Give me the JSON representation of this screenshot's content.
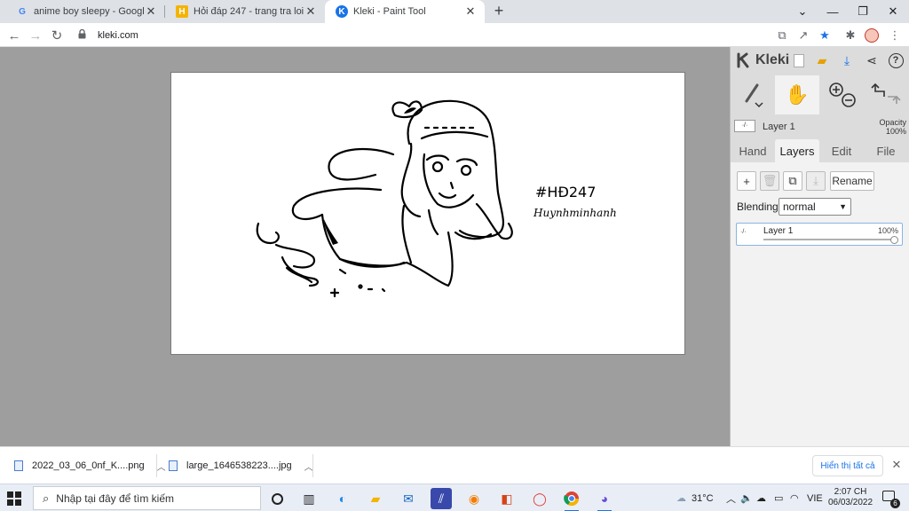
{
  "browser": {
    "tabs": [
      {
        "title": "anime boy sleepy - Google Tìm k",
        "icon": "google-icon",
        "active": false
      },
      {
        "title": "Hỏi đáp 247 - trang tra loi",
        "icon": "hoidap-icon",
        "active": false
      },
      {
        "title": "Kleki - Paint Tool",
        "icon": "kleki-icon",
        "active": true
      }
    ],
    "new_tab": "+",
    "window_controls": {
      "dropdown": "⌄",
      "minimize": "—",
      "restore": "❐",
      "close": "✕"
    },
    "nav": {
      "back": "←",
      "forward": "→",
      "reload": "↻"
    },
    "url": "kleki.com"
  },
  "kleki": {
    "logo_text": "Kleki",
    "tools": [
      "brush-tool",
      "hand-tool",
      "zoom-tool",
      "undo-redo"
    ],
    "layer_preview": {
      "name": "Layer 1",
      "opacity_label": "Opacity",
      "opacity_value": "100%"
    },
    "tabs": [
      {
        "label": "Hand",
        "active": false
      },
      {
        "label": "Layers",
        "active": true
      },
      {
        "label": "Edit",
        "active": false
      },
      {
        "label": "File",
        "active": false
      }
    ],
    "layer_buttons": {
      "add": "+",
      "delete": "🗑",
      "duplicate": "⧉",
      "merge": "⤓",
      "rename": "Rename"
    },
    "blending_label": "Blending",
    "blending_value": "normal",
    "layers": [
      {
        "name": "Layer 1",
        "opacity": "100%",
        "opacity_fraction": 1.0
      }
    ],
    "canvas_text": {
      "line1": "#HĐ247",
      "line2": "Huynhminhanh"
    }
  },
  "downloads": {
    "items": [
      {
        "name": "2022_03_06_0nf_K....png"
      },
      {
        "name": "large_1646538223....jpg"
      }
    ],
    "show_all": "Hiển thị tất cả"
  },
  "taskbar": {
    "search_placeholder": "Nhập tại đây để tìm kiếm",
    "weather": "31°C",
    "language": "VIE",
    "time": "2:07 CH",
    "date": "06/03/2022",
    "notifications": "6"
  }
}
